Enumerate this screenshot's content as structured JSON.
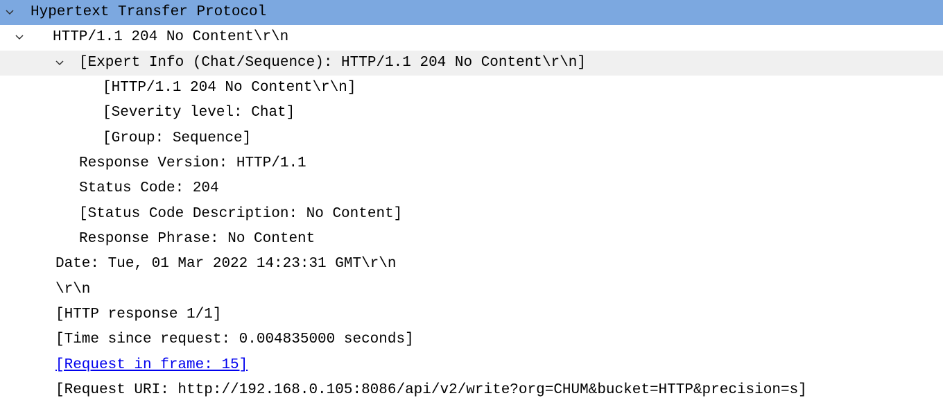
{
  "protocol_header": "Hypertext Transfer Protocol",
  "status_line": "HTTP/1.1 204 No Content\\r\\n",
  "expert_info": {
    "header": "[Expert Info (Chat/Sequence): HTTP/1.1 204 No Content\\r\\n]",
    "message": "[HTTP/1.1 204 No Content\\r\\n]",
    "severity": "[Severity level: Chat]",
    "group": "[Group: Sequence]"
  },
  "fields": {
    "response_version": "Response Version: HTTP/1.1",
    "status_code": "Status Code: 204",
    "status_code_desc": "[Status Code Description: No Content]",
    "response_phrase": "Response Phrase: No Content"
  },
  "date": "Date: Tue, 01 Mar 2022 14:23:31 GMT\\r\\n",
  "crlf": "\\r\\n",
  "http_response": "[HTTP response 1/1]",
  "time_since_request": "[Time since request: 0.004835000 seconds]",
  "request_in_frame": "[Request in frame: 15]",
  "request_uri": "[Request URI: http://192.168.0.105:8086/api/v2/write?org=CHUM&bucket=HTTP&precision=s]"
}
